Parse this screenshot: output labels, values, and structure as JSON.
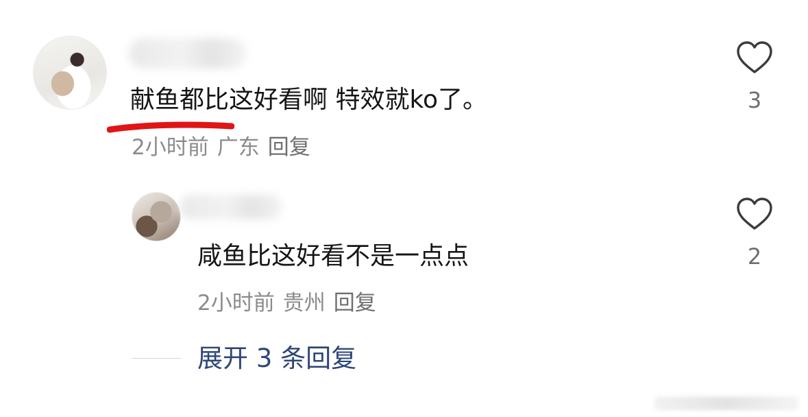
{
  "comments": [
    {
      "text": "献鱼都比这好看啊 特效就ko了。",
      "time": "2小时前",
      "location": "广东",
      "reply_label": "回复",
      "likes": "3"
    },
    {
      "text": "咸鱼比这好看不是一点点",
      "time": "2小时前",
      "location": "贵州",
      "reply_label": "回复",
      "likes": "2"
    }
  ],
  "expand": {
    "label": "展开 3 条回复"
  },
  "colors": {
    "underline": "#e01515",
    "expand_link": "#2e4677",
    "meta": "#8b8b8b"
  }
}
